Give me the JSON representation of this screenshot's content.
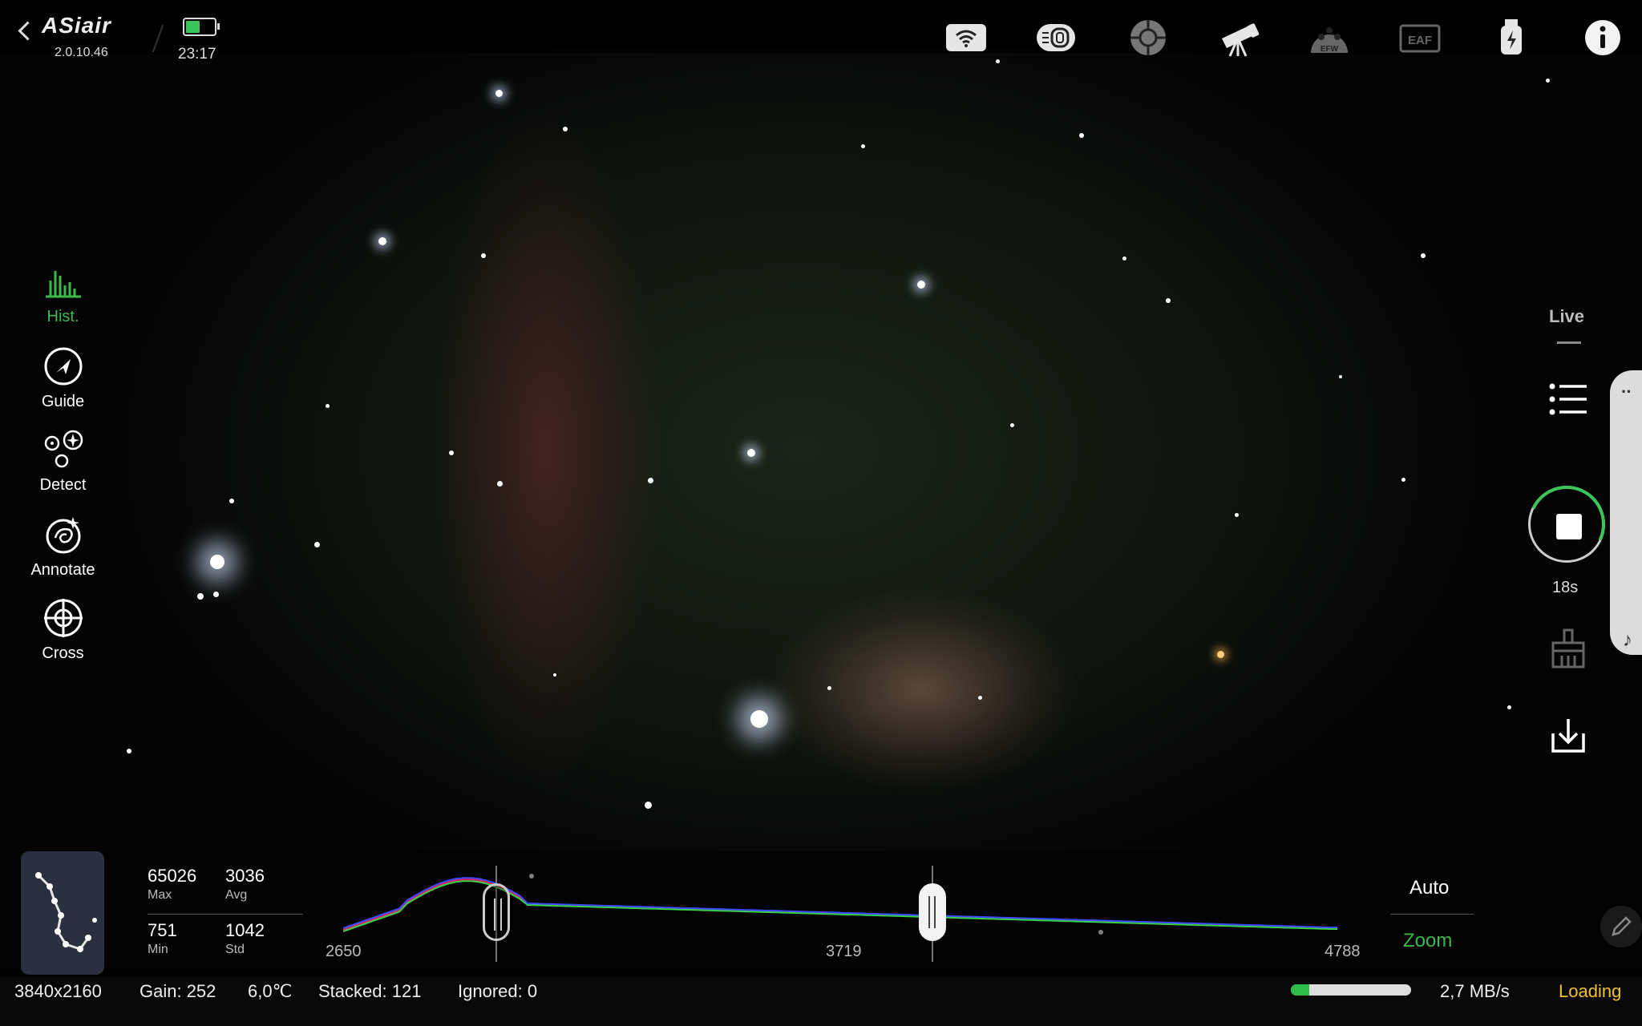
{
  "app": {
    "brand": "ASiair",
    "version": "2.0.10.46",
    "time": "23:17",
    "battery_level": 0.45
  },
  "topbar_icons": [
    "wifi-icon",
    "camera-lens-icon",
    "guide-scope-icon",
    "telescope-icon",
    "efw-filter-wheel-icon",
    "eaf-focuser-icon",
    "usb-power-icon",
    "info-icon"
  ],
  "topbar_icon_labels": {
    "efw": "EFW",
    "eaf": "EAF"
  },
  "left_menu": [
    {
      "label": "Hist.",
      "icon": "histogram-icon",
      "active": true
    },
    {
      "label": "Guide",
      "icon": "guide-icon",
      "active": false
    },
    {
      "label": "Detect",
      "icon": "detect-icon",
      "active": false
    },
    {
      "label": "Annotate",
      "icon": "annotate-icon",
      "active": false
    },
    {
      "label": "Cross",
      "icon": "crosshair-icon",
      "active": false
    }
  ],
  "right_panel": {
    "mode": "Live",
    "exposure_remaining": "18s",
    "icons": [
      "list-icon",
      "stop-icon",
      "clean-icon",
      "download-icon"
    ]
  },
  "histogram": {
    "stats": {
      "max_value": "65026",
      "max_label": "Max",
      "avg_value": "3036",
      "avg_label": "Avg",
      "min_value": "751",
      "min_label": "Min",
      "std_value": "1042",
      "std_label": "Std"
    },
    "axis": {
      "left": "2650",
      "mid": "3719",
      "right": "4788"
    },
    "auto_label": "Auto",
    "zoom_label": "Zoom",
    "colors": {
      "red": "#e0245c",
      "green": "#34d34a",
      "blue": "#3d4bff"
    }
  },
  "status": {
    "resolution": "3840x2160",
    "gain": "Gain: 252",
    "temperature": "6,0℃",
    "stacked": "Stacked: 121",
    "ignored": "Ignored: 0",
    "transfer_rate": "2,7 MB/s",
    "state": "Loading",
    "transfer_progress": 0.15
  },
  "colors": {
    "accent_green": "#3bb94a",
    "loading_yellow": "#f2c12e"
  }
}
